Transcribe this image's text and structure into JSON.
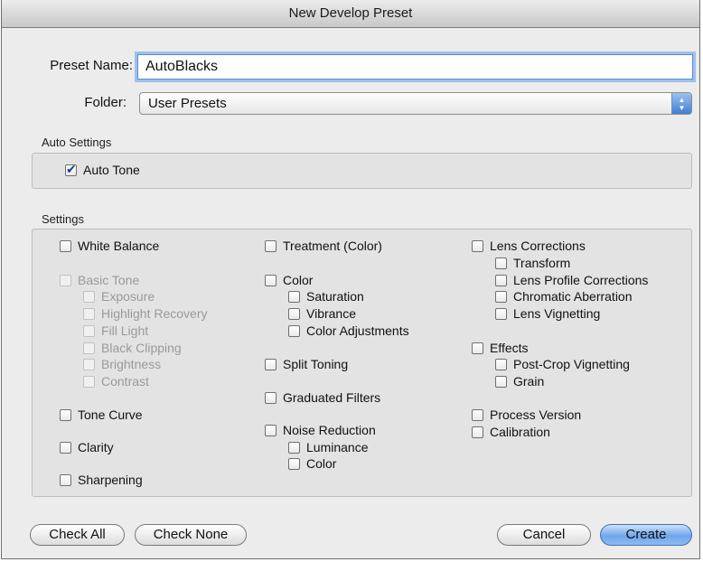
{
  "window": {
    "title": "New Develop Preset"
  },
  "preset_name": {
    "label": "Preset Name:",
    "value": "AutoBlacks"
  },
  "folder": {
    "label": "Folder:",
    "value": "User Presets"
  },
  "auto_settings": {
    "title": "Auto Settings",
    "auto_tone": {
      "label": "Auto Tone",
      "checked": true
    }
  },
  "settings": {
    "title": "Settings",
    "col1": {
      "white_balance": "White Balance",
      "basic_tone": "Basic Tone",
      "exposure": "Exposure",
      "highlight_recovery": "Highlight Recovery",
      "fill_light": "Fill Light",
      "black_clipping": "Black Clipping",
      "brightness": "Brightness",
      "contrast": "Contrast",
      "tone_curve": "Tone Curve",
      "clarity": "Clarity",
      "sharpening": "Sharpening"
    },
    "col2": {
      "treatment": "Treatment (Color)",
      "color": "Color",
      "saturation": "Saturation",
      "vibrance": "Vibrance",
      "color_adjustments": "Color Adjustments",
      "split_toning": "Split Toning",
      "graduated_filters": "Graduated Filters",
      "noise_reduction": "Noise Reduction",
      "luminance": "Luminance",
      "nr_color": "Color"
    },
    "col3": {
      "lens_corrections": "Lens Corrections",
      "transform": "Transform",
      "lens_profile": "Lens Profile Corrections",
      "chromatic_aberration": "Chromatic Aberration",
      "lens_vignetting": "Lens Vignetting",
      "effects": "Effects",
      "post_crop_vignetting": "Post-Crop Vignetting",
      "grain": "Grain",
      "process_version": "Process Version",
      "calibration": "Calibration"
    }
  },
  "buttons": {
    "check_all": "Check All",
    "check_none": "Check None",
    "cancel": "Cancel",
    "create": "Create"
  }
}
